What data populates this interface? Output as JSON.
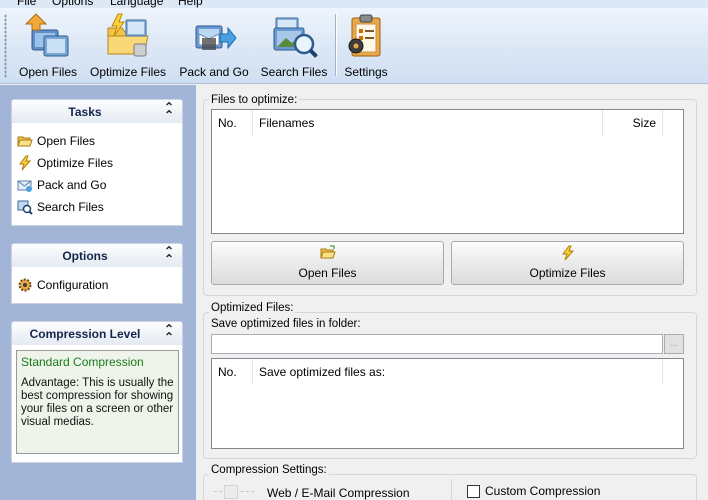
{
  "menu": {
    "items": [
      "File",
      "Options",
      "Language",
      "Help"
    ]
  },
  "toolbar": {
    "open": "Open Files",
    "optimize": "Optimize Files",
    "pack": "Pack and Go",
    "search": "Search Files",
    "settings": "Settings"
  },
  "tasks": {
    "title": "Tasks",
    "items": [
      "Open Files",
      "Optimize Files",
      "Pack and Go",
      "Search Files"
    ]
  },
  "options": {
    "title": "Options",
    "items": [
      "Configuration"
    ]
  },
  "compression_level": {
    "title": "Compression Level",
    "mode": "Standard Compression",
    "description": "Advantage: This is usually the best compression for showing your files on a screen or other visual medias."
  },
  "files_to_optimize": {
    "legend": "Files to optimize:",
    "columns": [
      "No.",
      "Filenames",
      "Size"
    ],
    "rows": [],
    "open_button": "Open Files",
    "optimize_button": "Optimize Files"
  },
  "optimized_files": {
    "legend": "Optimized Files:",
    "folder_label": "Save optimized files in folder:",
    "folder_value": "",
    "browse_label": "...",
    "columns": [
      "No.",
      "Save optimized files as:"
    ]
  },
  "compression_settings": {
    "legend": "Compression Settings:",
    "web_label": "Web / E-Mail Compression",
    "custom_label": "Custom Compression",
    "custom_checked": false
  }
}
